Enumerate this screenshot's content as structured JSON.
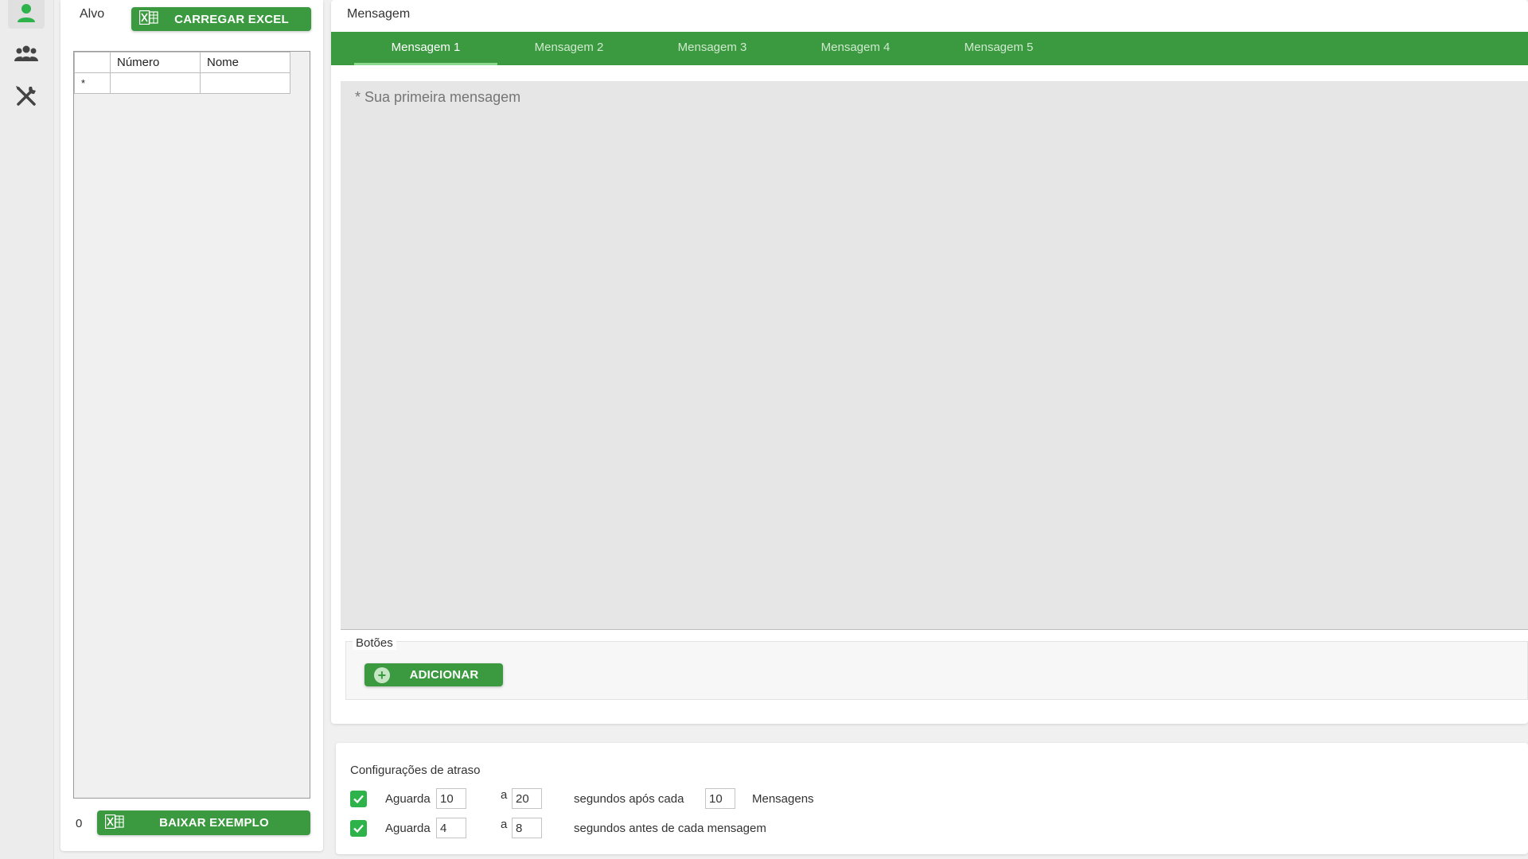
{
  "rail": {
    "items": [
      {
        "icon": "person-icon",
        "active": true
      },
      {
        "icon": "group-icon",
        "active": false
      },
      {
        "icon": "tools-icon",
        "active": false
      }
    ],
    "accent": "#2db34a"
  },
  "target": {
    "title": "Alvo",
    "load_excel_label": "CARREGAR EXCEL",
    "grid": {
      "columns": [
        "",
        "Número",
        "Nome"
      ],
      "rows": [
        [
          "*",
          "",
          ""
        ]
      ]
    },
    "count": "0",
    "download_example_label": "BAIXAR EXEMPLO"
  },
  "message": {
    "title": "Mensagem",
    "tabs": [
      "Mensagem 1",
      "Mensagem 2",
      "Mensagem 3",
      "Mensagem 4",
      "Mensagem 5"
    ],
    "active_tab": 0,
    "placeholder": "* Sua primeira mensagem",
    "buttons_section_label": "Botões",
    "add_label": "ADICIONAR"
  },
  "delay": {
    "title": "Configurações de atraso",
    "row1": {
      "checked": true,
      "wait_label": "Aguarda",
      "from": "10",
      "sep": "a",
      "to": "20",
      "after_label": "segundos após cada",
      "count": "10",
      "unit_label": "Mensagens"
    },
    "row2": {
      "checked": true,
      "wait_label": "Aguarda",
      "from": "4",
      "sep": "a",
      "to": "8",
      "before_label": "segundos antes de cada mensagem"
    }
  },
  "colors": {
    "primary_green": "#3b9a3f",
    "tab_indicator": "#8bd88e",
    "checkbox_green": "#2db34a"
  }
}
